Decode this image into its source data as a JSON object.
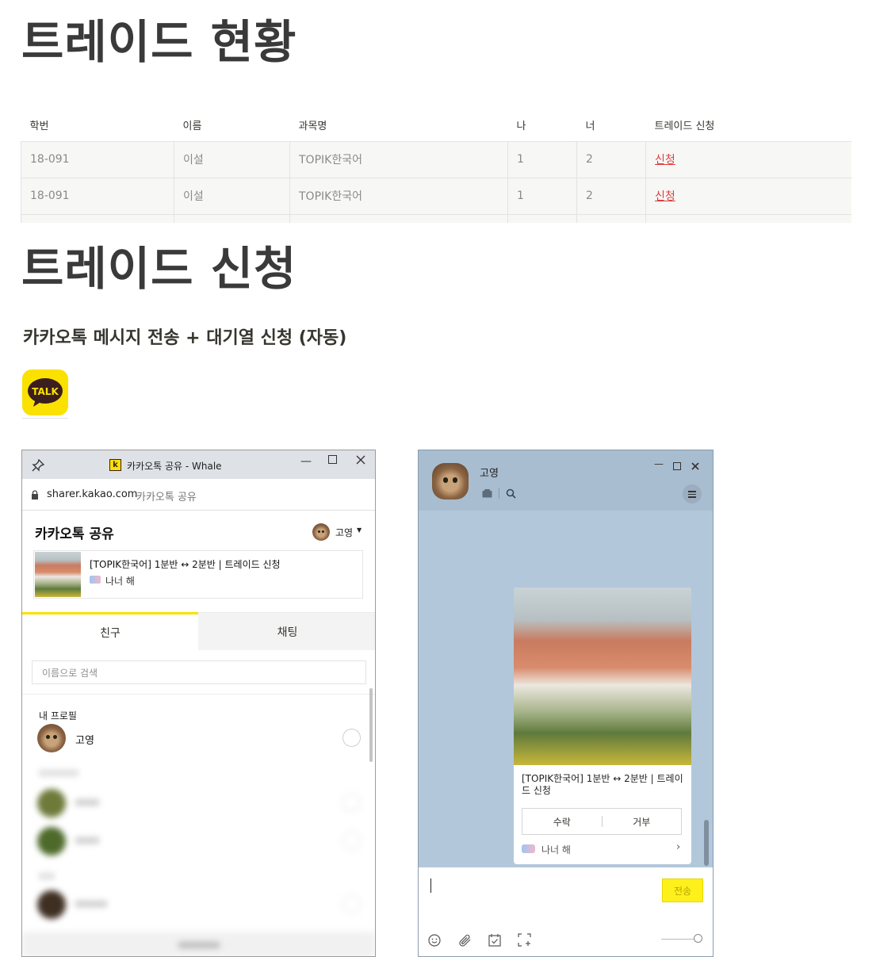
{
  "headings": {
    "status": "트레이드 현황",
    "apply": "트레이드 신청",
    "subtitle": "카카오톡 메시지 전송 + 대기열 신청 (자동)"
  },
  "table": {
    "headers": [
      "학번",
      "이름",
      "과목명",
      "나",
      "너",
      "트레이드 신청"
    ],
    "rows": [
      [
        "18-091",
        "이설",
        "TOPIK한국어",
        "1",
        "2",
        "신청"
      ],
      [
        "18-091",
        "이설",
        "TOPIK한국어",
        "1",
        "2",
        "신청"
      ]
    ]
  },
  "talk_logo": {
    "text": "TALK",
    "color": "#fae100"
  },
  "share_window": {
    "title": "카카오톡 공유 - Whale",
    "favicon": "k",
    "url_host": "sharer.kakao.com",
    "url_title": "카카오톡 공유",
    "heading": "카카오톡 공유",
    "user_name": "고영",
    "card_title": "[TOPIK한국어] 1분반 ↔ 2분반 | 트레이드 신청",
    "card_source": "나너 해",
    "tabs": [
      "친구",
      "채팅"
    ],
    "search_placeholder": "이름으로 검색",
    "my_profile_label": "내 프로필",
    "my_profile_name": "고영"
  },
  "chat_window": {
    "contact_name": "고영",
    "message_title": "[TOPIK한국어] 1분반 ↔ 2분반 | 트레이드 신청",
    "accept_label": "수락",
    "reject_label": "거부",
    "source_label": "나너 해",
    "send_label": "전송"
  },
  "icons": {
    "pin": "pin-icon",
    "lock": "lock-icon",
    "minimize": "minimize-icon",
    "maximize": "maximize-icon",
    "close": "close-icon",
    "search": "search-icon",
    "menu": "menu-icon",
    "emoji": "emoji-icon",
    "attach": "attach-icon",
    "calendar": "calendar-icon",
    "capture": "capture-icon"
  }
}
